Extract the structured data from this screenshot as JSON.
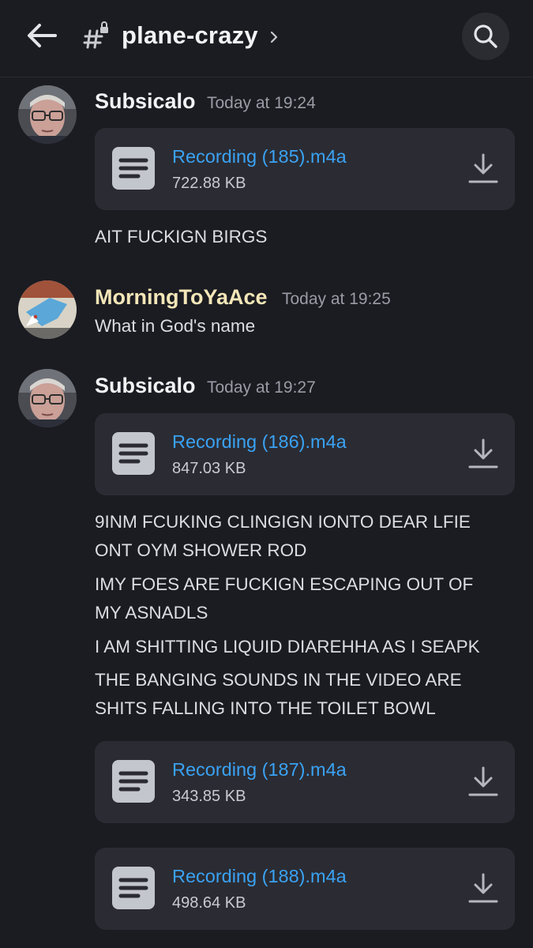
{
  "header": {
    "channel_name": "plane-crazy",
    "chevron": ">",
    "icons": {
      "back": "arrow-left-icon",
      "channel": "locked-hashtag-icon",
      "search": "search-icon"
    }
  },
  "messages": [
    {
      "author": "Subsicalo",
      "timestamp": "Today at 19:24",
      "attachments": [
        {
          "name": "Recording (185).m4a",
          "size": "722.88 KB"
        }
      ],
      "lines": [
        "AIT FUCKIGN BIRGS"
      ]
    },
    {
      "author": "MorningToYaAce",
      "timestamp": "Today at 19:25",
      "lines": [
        "What in God's name"
      ]
    },
    {
      "author": "Subsicalo",
      "timestamp": "Today at 19:27",
      "attachments": [
        {
          "name": "Recording (186).m4a",
          "size": "847.03 KB"
        },
        {
          "name": "Recording (187).m4a",
          "size": "343.85 KB"
        },
        {
          "name": "Recording (188).m4a",
          "size": "498.64 KB"
        }
      ],
      "lines": [
        "9INM FCUKING CLINGIGN IONTO DEAR LFIE",
        "ONT OYM SHOWER ROD",
        "IMY FOES ARE FUCKIGN ESCAPING OUT OF",
        "MY ASNADLS",
        "I AM SHITTING LIQUID DIAREHHA AS I SEAPK",
        "THE BANGING SOUNDS IN THE VIDEO ARE",
        "SHITS FALLING INTO THE TOILET BOWL"
      ]
    }
  ],
  "colors": {
    "background": "#1b1c21",
    "attachment_bg": "#2b2c33",
    "link": "#3aa2f4",
    "muted": "#9a9ca6"
  }
}
